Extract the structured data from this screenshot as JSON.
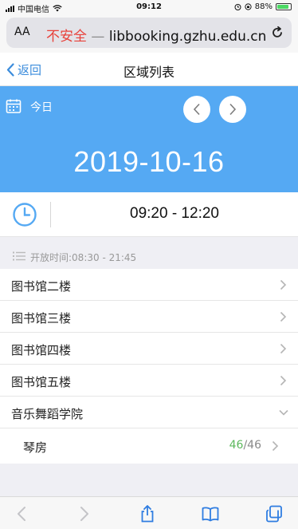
{
  "status_bar": {
    "carrier": "中国电信",
    "time": "09:12",
    "battery": "88%",
    "battery_level": 0.88
  },
  "browser": {
    "aa_label": "AA",
    "insecure_label": "不安全",
    "separator": "—",
    "host": "libbooking.gzhu.edu.cn"
  },
  "nav": {
    "back_label": "返回",
    "title": "区域列表"
  },
  "date_panel": {
    "today_label": "今日",
    "date": "2019-10-16"
  },
  "time_range": "09:20 - 12:20",
  "open_hours": "开放时间:08:30 - 21:45",
  "areas": [
    {
      "name": "图书馆二楼"
    },
    {
      "name": "图书馆三楼"
    },
    {
      "name": "图书馆四楼"
    },
    {
      "name": "图书馆五楼"
    }
  ],
  "expanded_area": {
    "name": "音乐舞蹈学院",
    "rooms": [
      {
        "name": "琴房",
        "available": "46",
        "total": "/46"
      }
    ]
  },
  "colors": {
    "accent": "#55a9f3",
    "link": "#3b8cdc",
    "available": "#5cb85c",
    "insecure": "#e8413a"
  }
}
